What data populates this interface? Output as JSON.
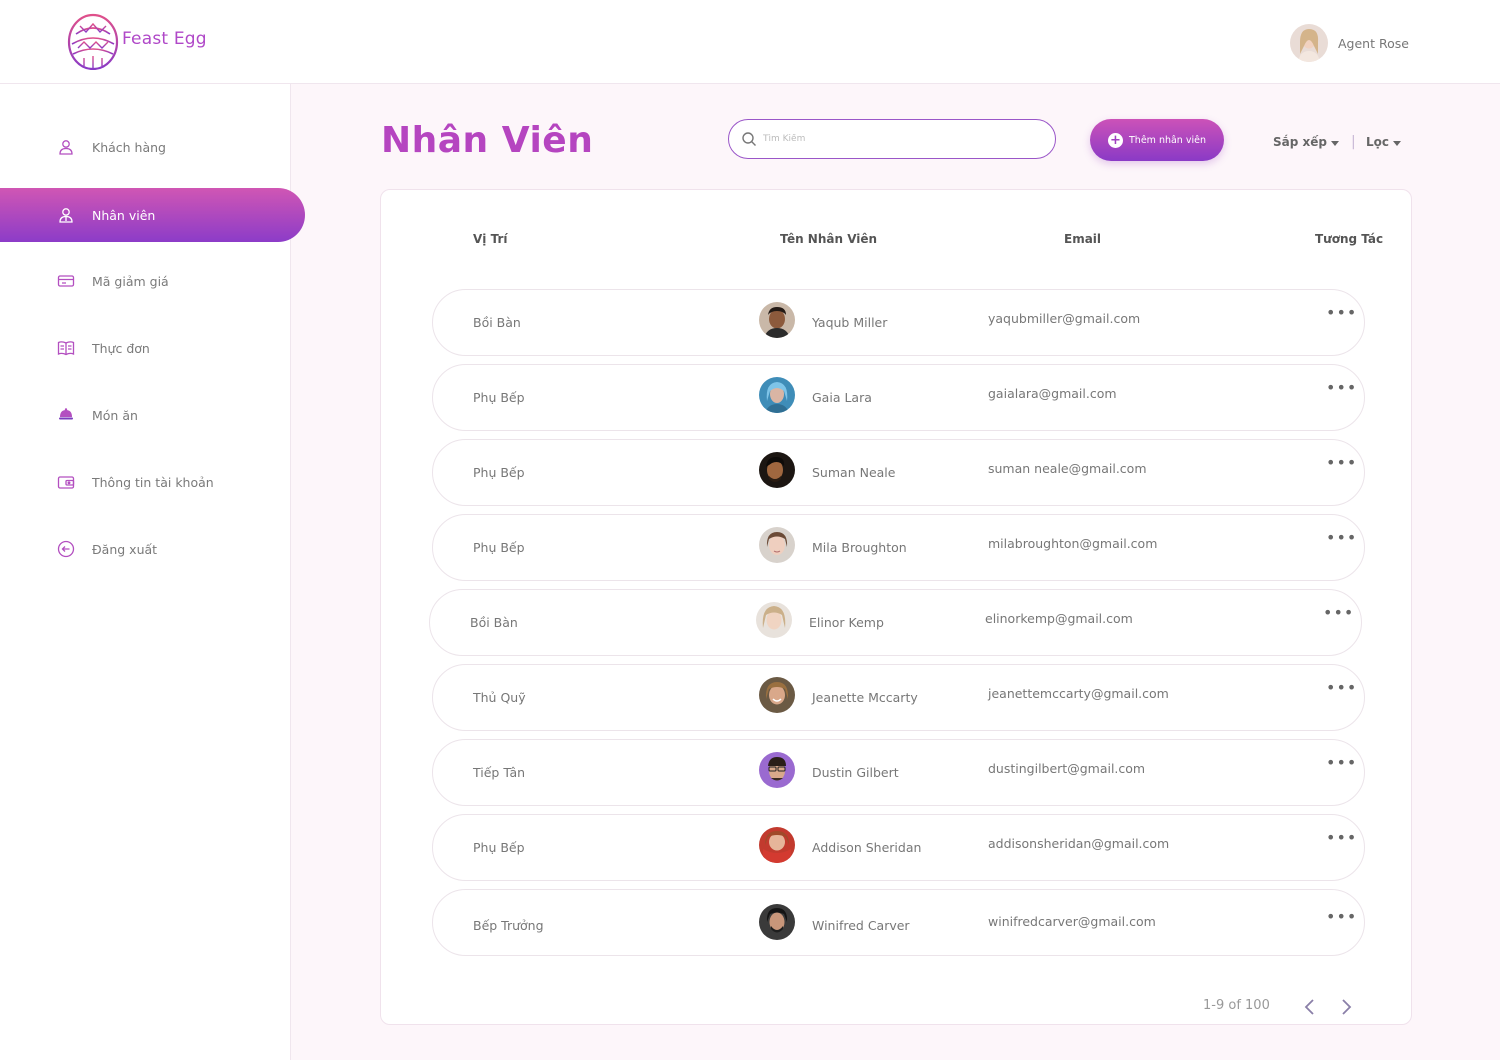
{
  "brand": {
    "name": "Feast Egg",
    "color": "#b048c8"
  },
  "user": {
    "name": "Agent Rose"
  },
  "sidebar": {
    "items": [
      {
        "label": "Khách hàng",
        "icon": "user-icon",
        "active": false
      },
      {
        "label": "Nhân viên",
        "icon": "staff-icon",
        "active": true
      },
      {
        "label": "Mã giảm giá",
        "icon": "coupon-icon",
        "active": false
      },
      {
        "label": "Thực đơn",
        "icon": "menu-book-icon",
        "active": false
      },
      {
        "label": "Món ăn",
        "icon": "dish-icon",
        "active": false
      },
      {
        "label": "Thông tin tài khoản",
        "icon": "wallet-icon",
        "active": false
      },
      {
        "label": "Đăng xuất",
        "icon": "logout-icon",
        "active": false
      }
    ]
  },
  "main": {
    "title": "Nhân Viên",
    "search_placeholder": "Tìm Kiếm",
    "add_label": "Thêm nhân viên",
    "sort_label": "Sắp xếp",
    "filter_label": "Lọc"
  },
  "table": {
    "headers": {
      "position": "Vị Trí",
      "name": "Tên Nhân Viên",
      "email": "Email",
      "action": "Tương Tác"
    },
    "rows": [
      {
        "position": "Bồi Bàn",
        "name": "Yaqub Miller",
        "email": "yaqubmiller@gmail.com"
      },
      {
        "position": "Phụ Bếp",
        "name": "Gaia Lara",
        "email": "gaialara@gmail.com"
      },
      {
        "position": "Phụ Bếp",
        "name": "Suman Neale",
        "email": "suman neale@gmail.com"
      },
      {
        "position": "Phụ Bếp",
        "name": "Mila Broughton",
        "email": "milabroughton@gmail.com"
      },
      {
        "position": "Bồi Bàn",
        "name": "Elinor Kemp",
        "email": "elinorkemp@gmail.com"
      },
      {
        "position": "Thủ Quỹ",
        "name": "Jeanette Mccarty",
        "email": "jeanettemccarty@gmail.com"
      },
      {
        "position": "Tiếp Tân",
        "name": "Dustin Gilbert",
        "email": "dustingilbert@gmail.com"
      },
      {
        "position": "Phụ Bếp",
        "name": "Addison Sheridan",
        "email": "addisonsheridan@gmail.com"
      },
      {
        "position": "Bếp Trưởng",
        "name": "Winifred Carver",
        "email": "winifredcarver@gmail.com"
      }
    ],
    "more_icon": "more-dots-icon"
  },
  "pagination": {
    "label": "1-9 of 100"
  },
  "colors": {
    "accent_start": "#d056b4",
    "accent_end": "#8c3cc8",
    "title": "#b545c0"
  }
}
